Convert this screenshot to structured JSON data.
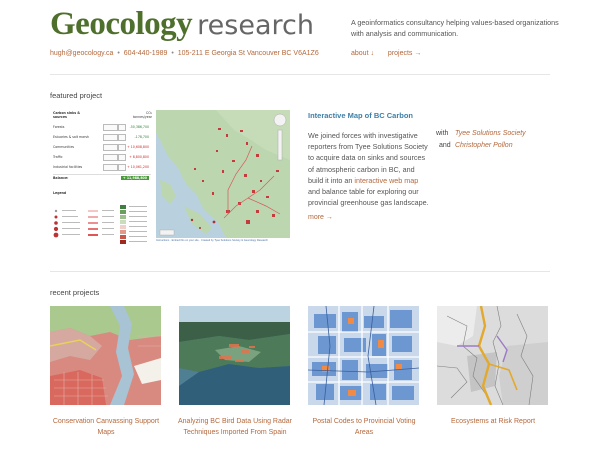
{
  "header": {
    "logo_bold": "Geocology",
    "logo_light": "research",
    "tagline": "A geoinformatics consultancy helping values-based organizations with analysis and communication.",
    "email": "hugh@geocology.ca",
    "phone": "604-440-1989",
    "address": "105-211 E Georgia St Vancouver BC V6A1Z6",
    "separator": "•",
    "nav": [
      {
        "label": "about ↓"
      },
      {
        "label": "projects →"
      }
    ]
  },
  "featured": {
    "heading": "featured project",
    "title": "Interactive Map of BC Carbon",
    "text_before_link": "We joined forces with investigative reporters from Tyee Solutions Society to acquire data on sinks and sources of atmospheric carbon in BC, and build it into an ",
    "link_text": "interactive web map",
    "text_after_link": " and balance table for exploring our provincial greenhouse gas landscape.",
    "more": "more →",
    "with_label": "with",
    "and_label": "and",
    "partners": [
      "Tyee Solutions Society",
      "Christopher Pollon"
    ],
    "screenshot": {
      "panel_title": "Carbon sinks & sources",
      "unit_header": "CO₂ tonnes/year",
      "rows": [
        {
          "label": "Forests",
          "value": "-50,386,700",
          "color": "#2e7d32"
        },
        {
          "label": "Estuaries & salt marsh",
          "value": "-178,700",
          "color": "#2e7d32"
        },
        {
          "label": "Communities",
          "value": "+ 10,608,800",
          "color": "#c62828"
        },
        {
          "label": "Traffic",
          "value": "+ 8,800,800",
          "color": "#c62828"
        },
        {
          "label": "Industrial facilities",
          "value": "+ 10,061,200",
          "color": "#c62828"
        }
      ],
      "balance_label": "Balance:",
      "balance_value": "+ 11,988,800",
      "legend_title": "Legend",
      "caption": "Instructions · Embed this on your site · Created by Tyee Solutions Society & Geocology Research"
    }
  },
  "recent": {
    "heading": "recent projects",
    "projects": [
      {
        "title": "Conservation Canvassing Support Maps"
      },
      {
        "title": "Analyzing BC Bird Data Using Radar Techniques Imported From Spain"
      },
      {
        "title": "Postal Codes to Provincial Voting Areas"
      },
      {
        "title": "Ecosystems at Risk Report"
      }
    ]
  }
}
